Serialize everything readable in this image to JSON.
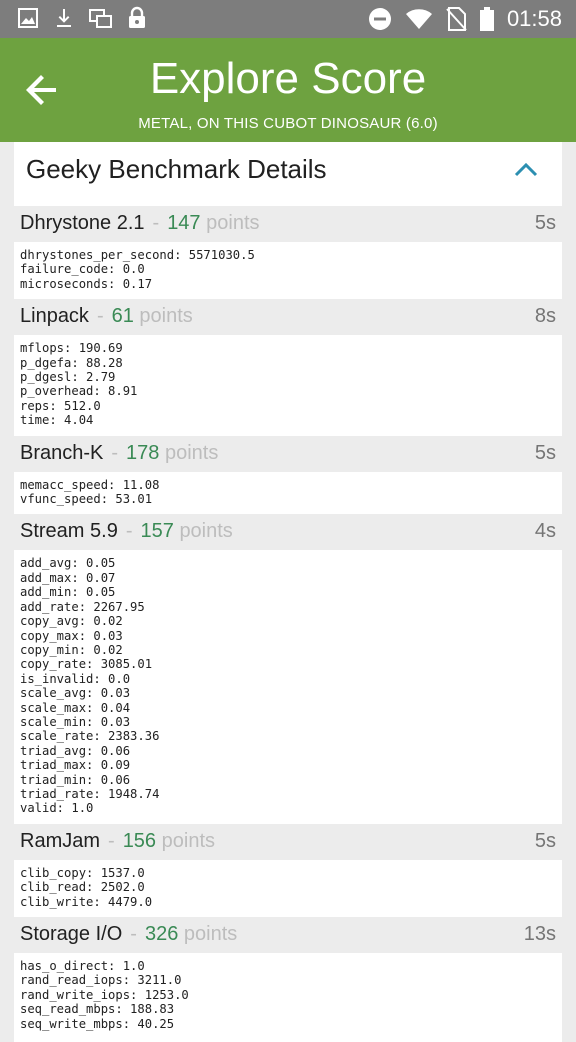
{
  "status_bar": {
    "icons_left": [
      "image-icon",
      "download-icon",
      "multi-window-icon",
      "lock-icon"
    ],
    "icons_right": [
      "do-not-disturb-icon",
      "wifi-icon",
      "no-sim-icon",
      "battery-icon"
    ],
    "time": "01:58"
  },
  "app_bar": {
    "title": "Explore Score",
    "subtitle": "METAL, ON THIS CUBOT DINOSAUR (6.0)",
    "background_color": "#6ea240"
  },
  "card": {
    "title": "Geeky Benchmark Details"
  },
  "tests": [
    {
      "name": "Dhrystone 2.1",
      "score": "147",
      "points_label": "points",
      "time": "5s",
      "metrics": [
        "dhrystones_per_second: 5571030.5",
        "failure_code: 0.0",
        "microseconds: 0.17"
      ]
    },
    {
      "name": "Linpack",
      "score": "61",
      "points_label": "points",
      "time": "8s",
      "metrics": [
        "mflops: 190.69",
        "p_dgefa: 88.28",
        "p_dgesl: 2.79",
        "p_overhead: 8.91",
        "reps: 512.0",
        "time: 4.04"
      ]
    },
    {
      "name": "Branch-K",
      "score": "178",
      "points_label": "points",
      "time": "5s",
      "metrics": [
        "memacc_speed: 11.08",
        "vfunc_speed: 53.01"
      ]
    },
    {
      "name": "Stream 5.9",
      "score": "157",
      "points_label": "points",
      "time": "4s",
      "metrics": [
        "add_avg: 0.05",
        "add_max: 0.07",
        "add_min: 0.05",
        "add_rate: 2267.95",
        "copy_avg: 0.02",
        "copy_max: 0.03",
        "copy_min: 0.02",
        "copy_rate: 3085.01",
        "is_invalid: 0.0",
        "scale_avg: 0.03",
        "scale_max: 0.04",
        "scale_min: 0.03",
        "scale_rate: 2383.36",
        "triad_avg: 0.06",
        "triad_max: 0.09",
        "triad_min: 0.06",
        "triad_rate: 1948.74",
        "valid: 1.0"
      ]
    },
    {
      "name": "RamJam",
      "score": "156",
      "points_label": "points",
      "time": "5s",
      "metrics": [
        "clib_copy: 1537.0",
        "clib_read: 2502.0",
        "clib_write: 4479.0"
      ]
    },
    {
      "name": "Storage I/O",
      "score": "326",
      "points_label": "points",
      "time": "13s",
      "metrics": [
        "has_o_direct: 1.0",
        "rand_read_iops: 3211.0",
        "rand_write_iops: 1253.0",
        "seq_read_mbps: 188.83",
        "seq_write_mbps: 40.25"
      ]
    }
  ]
}
